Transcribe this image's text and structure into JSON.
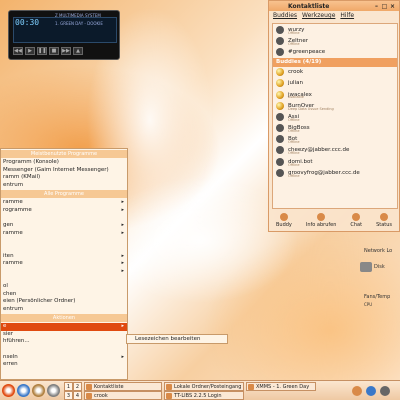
{
  "player": {
    "time": "00:30",
    "title": "Z MULTIMEDIA SYSTEM",
    "info": "1. GREEN DAY - DOOKIE"
  },
  "contacts_window": {
    "title": "Kontaktliste",
    "menu": [
      "Buddies",
      "Werkzeuge",
      "Hilfe"
    ],
    "top_contacts": [
      {
        "name": "wurzy",
        "status": "Offline"
      },
      {
        "name": "Zeltner",
        "status": "Offline"
      },
      {
        "name": "#greenpeace",
        "status": ""
      }
    ],
    "group_label": "Buddies (4/19)",
    "contacts": [
      {
        "name": "crook",
        "status": "",
        "online": true
      },
      {
        "name": "julian",
        "status": "",
        "online": true
      },
      {
        "name": "jwacalex",
        "status": "Available",
        "online": true
      },
      {
        "name": "BurnOver",
        "status": "Deep Data Ussue Sending",
        "online": true
      },
      {
        "name": "Assi",
        "status": "Offline",
        "online": false
      },
      {
        "name": "BigBoss",
        "status": "Offline",
        "online": false
      },
      {
        "name": "Bot",
        "status": "Offline",
        "online": false
      },
      {
        "name": "cheezy@jabber.ccc.de",
        "status": "Offline",
        "online": false
      },
      {
        "name": "domi.bot",
        "status": "Offline",
        "online": false
      },
      {
        "name": "groovyfrog@jabber.ccc.de",
        "status": "Offline",
        "online": false
      }
    ],
    "bottom_buttons": [
      "Buddy",
      "Info abrufen",
      "Chat",
      "Status"
    ]
  },
  "sysmon": {
    "network": "Network Lo",
    "disk": "Disk",
    "fans": "Fans/Temp",
    "cpu": "CPU"
  },
  "kmenu": {
    "recent_header": "Meistbenutzte Programme",
    "recent": [
      "Programm (Konsole)",
      "Messenger (Gaim Internet Messenger)",
      "ramm (KMail)",
      "entrum"
    ],
    "all_header": "Alle Programme",
    "all": [
      "ramme",
      "rogramme",
      "",
      "gen",
      "ramme",
      "",
      "",
      "iten",
      "ramme",
      "",
      "",
      "ol",
      "chen",
      "eien (Persönlicher Ordner)"
    ],
    "control": "entrum",
    "actions_header": "Aktionen",
    "actions": [
      "e",
      "sier",
      "hführen...",
      "",
      "nseln",
      "erren"
    ],
    "selected_index": 0,
    "submenu_item": "Lesezeichen bearbeiten"
  },
  "taskbar": {
    "pager": [
      "1",
      "2",
      "3",
      "4"
    ],
    "tasks": [
      "Kontaktliste",
      "crook",
      "Lokale Ordner/Posteingang",
      "TT-LIBS 2.2.5 Login",
      "XMMS - 1. Green Day"
    ]
  }
}
